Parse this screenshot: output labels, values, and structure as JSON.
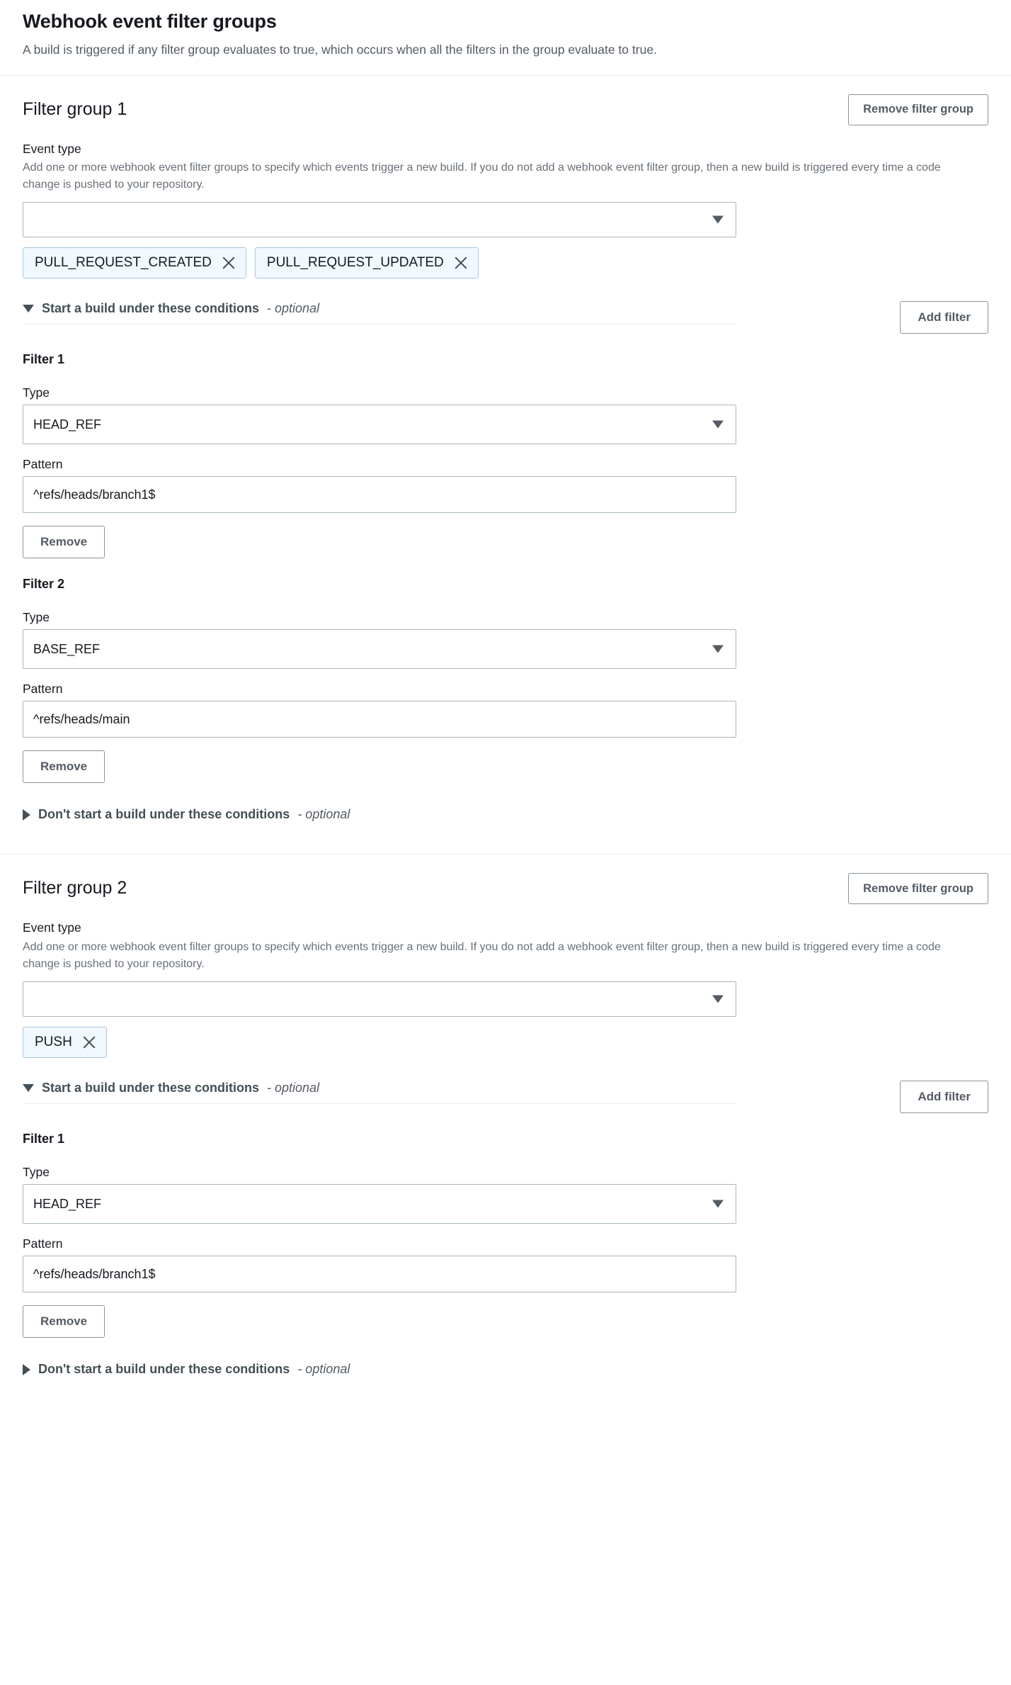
{
  "header": {
    "title": "Webhook event filter groups",
    "description": "A build is triggered if any filter group evaluates to true, which occurs when all the filters in the group evaluate to true."
  },
  "labels": {
    "remove_filter_group": "Remove filter group",
    "add_filter": "Add filter",
    "remove": "Remove",
    "event_type_label": "Event type",
    "event_type_description": "Add one or more webhook event filter groups to specify which events trigger a new build. If you do not add a webhook event filter group, then a new build is triggered every time a code change is pushed to your repository.",
    "type_label": "Type",
    "pattern_label": "Pattern",
    "start_build_label": "Start a build under these conditions",
    "dont_start_build_label": "Don't start a build under these conditions",
    "optional_suffix": "- optional",
    "event_type_placeholder": ""
  },
  "colors": {
    "token_bg": "#f1f8ff",
    "token_border": "#a9c7e0",
    "button_border": "#879596",
    "button_text": "#545b64",
    "input_border": "#aab7b8",
    "divider": "#eaeded",
    "text_primary": "#16191f",
    "text_secondary": "#545b64"
  },
  "icons": {
    "chevron_down": "caret-down-icon",
    "token_remove": "close-x-icon",
    "expanded": "triangle-down-icon",
    "collapsed": "triangle-right-icon"
  },
  "groups": [
    {
      "title": "Filter group 1",
      "event_type_value": "",
      "event_types": [
        {
          "label": "PULL_REQUEST_CREATED"
        },
        {
          "label": "PULL_REQUEST_UPDATED"
        }
      ],
      "start_expanded": true,
      "filters": [
        {
          "title": "Filter 1",
          "type": "HEAD_REF",
          "pattern": "^refs/heads/branch1$"
        },
        {
          "title": "Filter 2",
          "type": "BASE_REF",
          "pattern": "^refs/heads/main"
        }
      ]
    },
    {
      "title": "Filter group 2",
      "event_type_value": "",
      "event_types": [
        {
          "label": "PUSH"
        }
      ],
      "start_expanded": true,
      "filters": [
        {
          "title": "Filter 1",
          "type": "HEAD_REF",
          "pattern": "^refs/heads/branch1$"
        }
      ]
    }
  ]
}
